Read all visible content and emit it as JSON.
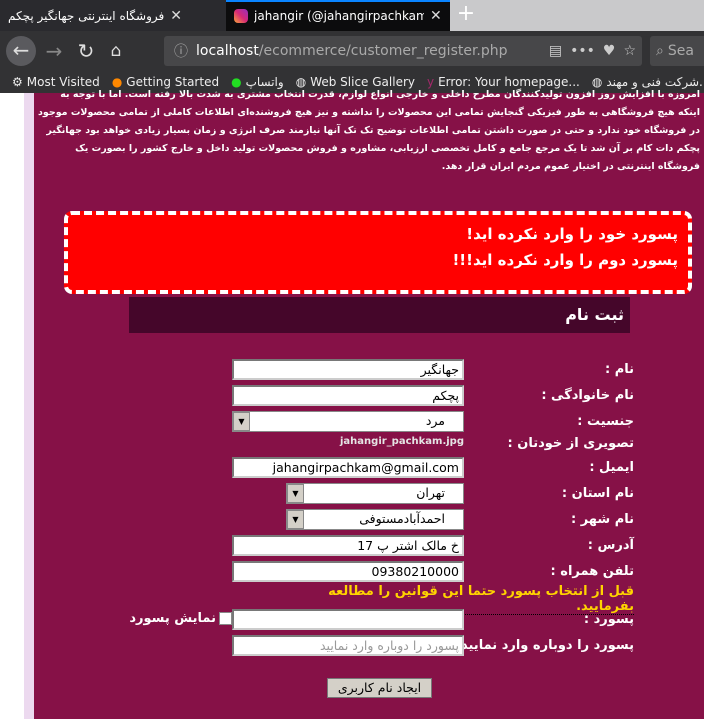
{
  "browser": {
    "tabs": [
      {
        "title": "فروشگاه اینترنتی جهانگیر پچکم"
      },
      {
        "title": "jahangir (@jahangirpachkam) • Ins"
      }
    ],
    "url_host": "localhost",
    "url_path": "/ecommerce/customer_register.php",
    "search_placeholder": "Sea",
    "bookmarks": [
      "Most Visited",
      "Getting Started",
      "واتساپ",
      "Web Slice Gallery",
      "Error: Your homepage...",
      "شرکت فنی و مهند..."
    ]
  },
  "intro_text": "امروزه با افزایش روز افزون تولیدکنندگان مطرح داخلی و خارجی انواع لوازم، قدرت انتخاب مشتری به شدت بالا رفته است. اما با توجه به اینکه هیچ فروشگاهی به طور فیزیکی گنجایش تمامی این محصولات را نداشته و نیز هیچ فروشنده‌ای اطلاعات کاملی از تمامی محصولات موجود در فروشگاه خود ندارد و حتی در صورت داشتن تمامی اطلاعات توضیح تک تک آنها نیازمند صرف انرژی و زمان بسیار زیادی خواهد بود جهانگیر پچکم دات کام بر آن شد تا یک مرجع جامع و کامل تخصصی ارزیابی، مشاوره و فروش محصولات تولید داخل و خارج کشور را بصورت یک فروشگاه اینترنتی در اختیار عموم مردم ایران قرار دهد.",
  "errors": [
    "پسورد خود را وارد نکرده اید!",
    "پسورد دوم را وارد نکرده اید!!!"
  ],
  "form": {
    "title": "ثبت نام",
    "first_name": {
      "label": "نام :",
      "value": "جهانگیر"
    },
    "last_name": {
      "label": "نام خانوادگی :",
      "value": "پچکم"
    },
    "gender": {
      "label": "جنسیت :",
      "value": "مرد"
    },
    "photo": {
      "label": "تصویری از خودتان :",
      "value": "jahangir_pachkam.jpg"
    },
    "email": {
      "label": "ایمیل :",
      "value": "jahangirpachkam@gmail.com"
    },
    "province": {
      "label": "نام استان :",
      "value": "تهران"
    },
    "city": {
      "label": "نام شهر :",
      "value": "احمدآبادمستوفی"
    },
    "address": {
      "label": "آدرس :",
      "value": "خ مالک اشتر پ 17"
    },
    "phone": {
      "label": "تلفن همراه :",
      "value": "09380210000"
    },
    "notice": "قبل از انتخاب پسورد حتما این قوانین را مطالعه بفرمایید.",
    "password": {
      "label": "پسورد :",
      "value": ""
    },
    "show_password": "نمایش پسورد",
    "password2": {
      "label": "پسورد را دوباره وارد نمایید :",
      "placeholder": "پسورد را دوباره وارد نمایید"
    },
    "submit": "ایجاد نام کاربری"
  }
}
